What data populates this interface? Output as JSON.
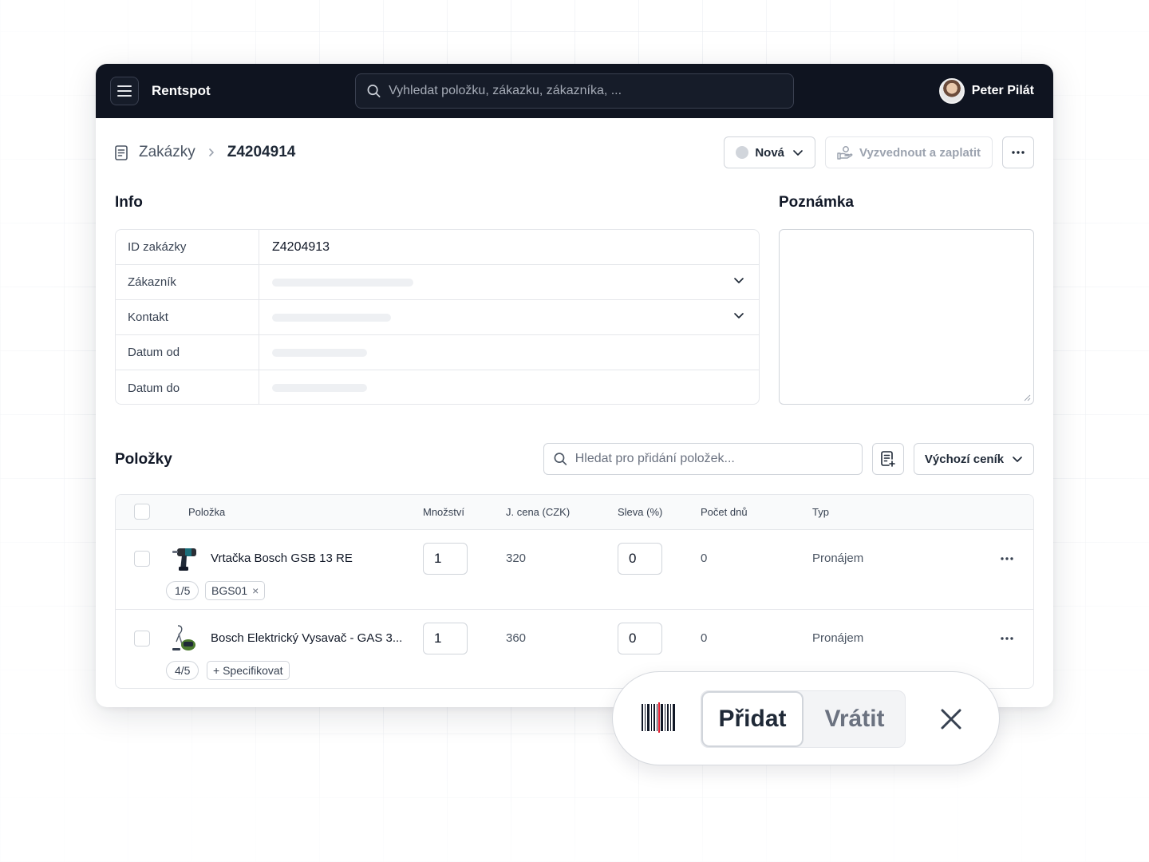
{
  "topbar": {
    "brand": "Rentspot",
    "search_placeholder": "Vyhledat položku, zákazku, zákazníka, ...",
    "user_name": "Peter Pilát"
  },
  "breadcrumb": {
    "parent": "Zakázky",
    "current": "Z4204914"
  },
  "actions": {
    "status": "Nová",
    "pickup_pay": "Vyzvednout a zaplatit"
  },
  "info": {
    "title": "Info",
    "rows": [
      {
        "label": "ID zakázky",
        "value": "Z4204913"
      },
      {
        "label": "Zákazník"
      },
      {
        "label": "Kontakt"
      },
      {
        "label": "Datum od"
      },
      {
        "label": "Datum do"
      }
    ]
  },
  "note": {
    "title": "Poznámka"
  },
  "items": {
    "title": "Položky",
    "search_placeholder": "Hledat pro přidání položek...",
    "pricelist": "Výchozí ceník",
    "columns": [
      "Položka",
      "Množství",
      "J. cena (CZK)",
      "Sleva (%)",
      "Počet dnů",
      "Typ"
    ],
    "rows": [
      {
        "name": "Vrtačka Bosch GSB 13 RE",
        "quantity": "1",
        "unit_price": "320",
        "discount": "0",
        "days": "0",
        "type": "Pronájem",
        "availability": "1/5",
        "tag": "BGS01",
        "tag_remove": "×"
      },
      {
        "name": "Bosch Elektrický Vysavač - GAS 3...",
        "quantity": "1",
        "unit_price": "360",
        "discount": "0",
        "days": "0",
        "type": "Pronájem",
        "availability": "4/5",
        "specify": "+ Specifikovat"
      }
    ]
  },
  "scanner": {
    "add": "Přidat",
    "return": "Vrátit",
    "close": "✕"
  },
  "colors": {
    "topbar": "#0f1420",
    "border": "#e5e7eb",
    "scanner_red": "#e11d2e"
  }
}
